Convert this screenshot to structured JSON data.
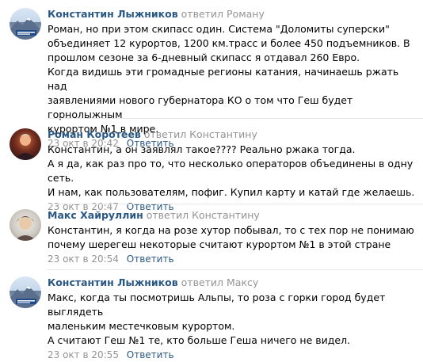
{
  "comments": [
    {
      "avatar_kind": "mountain-sign",
      "author": "Константин Лыжников",
      "replied": "ответил Роману",
      "lines": [
        "Роман, но при этом скипасс один. Система \"Доломиты суперски\"",
        "объединяет 12 курортов, 1200 км.трасс и более 450 подъемников. В",
        "прошлом сезоне за 6-дневный скипасс я отдавал 260 Евро.",
        "Когда видишь эти громадные регионы катания, начинаешь ржать над",
        "заявлениями нового губернатора КО о том что Геш будет горнолыжным",
        "курортом №1 в мире."
      ],
      "time": "23 окт в 20:42",
      "reply_label": "Ответить"
    },
    {
      "avatar_kind": "portrait",
      "author": "Роман Коротеев",
      "replied": "ответил Константину",
      "lines": [
        "Константин, а он заявлял такое???? Реально ржака тогда.",
        "А я да, как раз про то, что несколько операторов объединены в одну сеть.",
        "И нам, как пользователям, пофиг. Купил карту и катай где желаешь."
      ],
      "time": "23 окт в 20:47",
      "reply_label": "Ответить"
    },
    {
      "avatar_kind": "portrait",
      "author": "Макс Хайруллин",
      "replied": "ответил Константину",
      "lines": [
        "Константин, я когда на розе хутор побывал, то с тех пор не понимаю",
        "почему шерегеш некоторые считают курортом №1 в этой стране"
      ],
      "time": "23 окт в 20:54",
      "reply_label": "Ответить"
    },
    {
      "avatar_kind": "mountain-sign",
      "author": "Константин Лыжников",
      "replied": "ответил Максу",
      "lines": [
        "Макс, когда ты посмотришь Альпы, то роза с горки город будет выглядеть",
        "маленьким местечковым курортом.",
        "А считают Геш №1 те, кто больше Геша ничего не видел."
      ],
      "time": "23 окт в 20:55",
      "reply_label": "Ответить"
    }
  ]
}
